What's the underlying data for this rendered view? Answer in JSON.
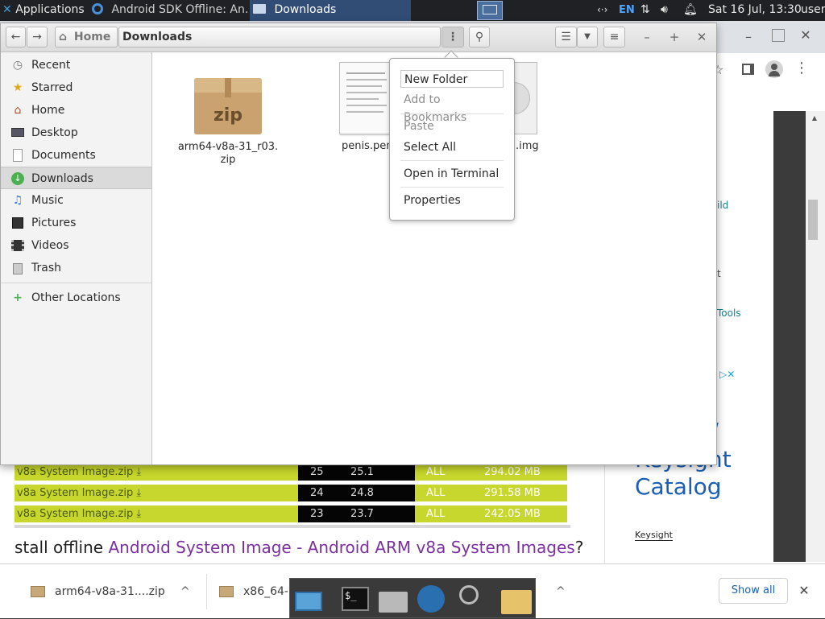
{
  "top_panel": {
    "applications_label": "Applications",
    "tasks": [
      {
        "label": "Android SDK Offline: An...",
        "active": false
      },
      {
        "label": "Downloads",
        "active": true
      }
    ],
    "keyboard_layout": "EN",
    "clock": "Sat 16 Jul, 13:30",
    "user": "user"
  },
  "file_manager": {
    "path": [
      "Home",
      "Downloads"
    ],
    "sidebar": [
      {
        "label": "Recent",
        "icon": "clock-icon"
      },
      {
        "label": "Starred",
        "icon": "star-icon"
      },
      {
        "label": "Home",
        "icon": "home-icon"
      },
      {
        "label": "Desktop",
        "icon": "desktop-icon"
      },
      {
        "label": "Documents",
        "icon": "document-icon"
      },
      {
        "label": "Downloads",
        "icon": "download-icon",
        "selected": true
      },
      {
        "label": "Music",
        "icon": "music-icon"
      },
      {
        "label": "Pictures",
        "icon": "picture-icon"
      },
      {
        "label": "Videos",
        "icon": "video-icon"
      },
      {
        "label": "Trash",
        "icon": "trash-icon"
      },
      {
        "label": "Other Locations",
        "icon": "plus-icon"
      }
    ],
    "files": [
      {
        "name": "arm64-v8a-31_r03.zip",
        "line1": "arm64-v8a-31_r03.",
        "line2": "zip",
        "icon_text": "zip"
      },
      {
        "name_visible": "penis.pen",
        "icon": "text-document-icon"
      },
      {
        "name_visible": ".img",
        "icon": "disc-image-icon"
      }
    ],
    "menu": {
      "items": [
        {
          "label": "New Folder",
          "enabled": true
        },
        {
          "label": "Add to Bookmarks",
          "enabled": false
        },
        {
          "label": "Paste",
          "enabled": false
        },
        {
          "label": "Select All",
          "enabled": true
        },
        {
          "label": "Open in Terminal",
          "enabled": true
        },
        {
          "label": "Properties",
          "enabled": true
        }
      ]
    }
  },
  "browser_page": {
    "side_fragments": [
      "ild",
      "t",
      "Tools"
    ],
    "ad": {
      "line1": "w",
      "line2": "Keysight",
      "line3": "Catalog",
      "brand": "Keysight"
    },
    "table_rows": [
      {
        "name": "v8a System Image.zip",
        "api": "25",
        "ver": "25.1",
        "abi": "ALL",
        "size": "294.02 MB"
      },
      {
        "name": "v8a System Image.zip",
        "api": "24",
        "ver": "24.8",
        "abi": "ALL",
        "size": "291.58 MB"
      },
      {
        "name": "v8a System Image.zip",
        "api": "23",
        "ver": "23.7",
        "abi": "ALL",
        "size": "242.05 MB"
      }
    ],
    "heading_prefix": "stall offline ",
    "heading_link": "Android System Image - Android ARM v8a System Images",
    "heading_suffix": "?"
  },
  "downloads_bar": {
    "items": [
      "arm64-v8a-31....zip",
      "x86_64-"
    ],
    "show_all": "Show all"
  },
  "colors": {
    "table_green": "#c8d72d",
    "link_purple": "#7b2fa0",
    "ad_blue": "#1a5fb4",
    "selected_task": "#314d75"
  }
}
